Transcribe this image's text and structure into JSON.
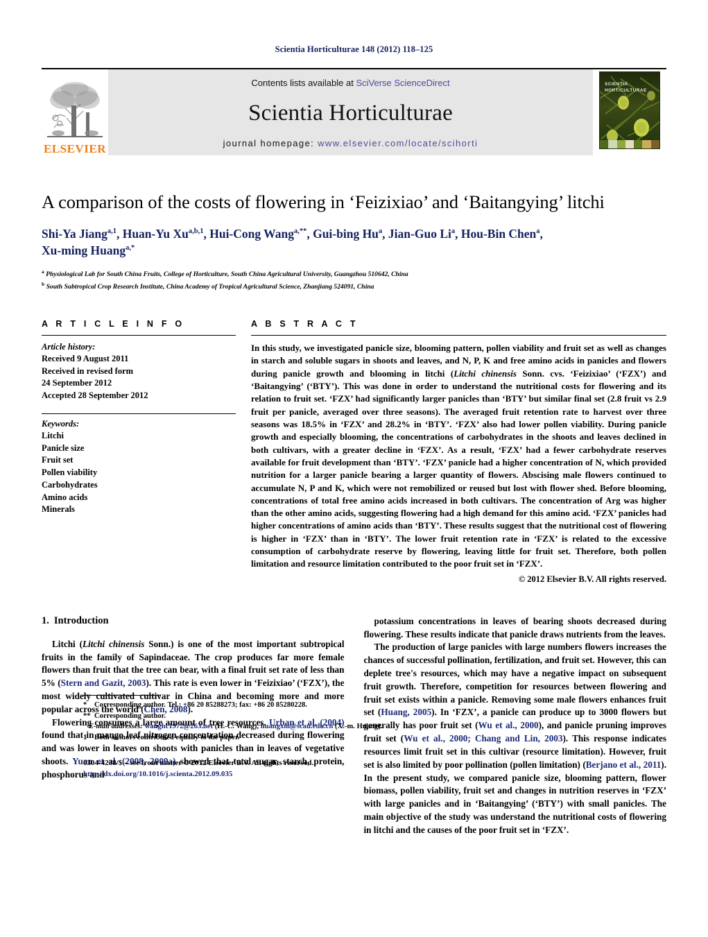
{
  "running_head": "Scientia Horticulturae 148 (2012) 118–125",
  "masthead": {
    "publisher_name": "ELSEVIER",
    "contents_prefix": "Contents lists available at ",
    "contents_link": "SciVerse ScienceDirect",
    "journal_title": "Scientia Horticulturae",
    "homepage_prefix": "journal homepage: ",
    "homepage_url": "www.elsevier.com/locate/scihorti",
    "cover_label_line1": "SCIENTIA",
    "cover_label_line2": "HORTICULTURAE",
    "link_color": "#4a4a9c",
    "logo_color": "#f07e13",
    "panel_bg": "#e6e6e6"
  },
  "article": {
    "title": "A comparison of the costs of flowering in ‘Feizixiao’ and ‘Baitangying’ litchi",
    "authors_line1": "Shi-Ya Jiang<sup>a,1</sup>, Huan-Yu Xu<sup>a,b,1</sup>, Hui-Cong Wang<sup>a,**</sup>, Gui-bing Hu<sup>a</sup>, Jian-Guo Li<sup>a</sup>, Hou-Bin Chen<sup>a</sup>,",
    "authors_line2": "Xu-ming Huang<sup>a,*</sup>",
    "authors_color": "#13205e",
    "affiliation_a": "<sup>a</sup> Physiological Lab for South China Fruits, College of Horticulture, South China Agricultural University, Guangzhou 510642, China",
    "affiliation_b": "<sup>b</sup> South Subtropical Crop Research Institute, China Academy of Tropical Agricultural Science, Zhanjiang 524091, China"
  },
  "article_info": {
    "label": "A R T I C L E   I N F O",
    "history_label": "Article history:",
    "history": [
      "Received 9 August 2011",
      "Received in revised form",
      "24 September 2012",
      "Accepted 28 September 2012"
    ],
    "keywords_label": "Keywords:",
    "keywords": [
      "Litchi",
      "Panicle size",
      "Fruit set",
      "Pollen viability",
      "Carbohydrates",
      "Amino acids",
      "Minerals"
    ]
  },
  "abstract": {
    "label": "A B S T R A C T",
    "html": "In this study, we investigated panicle size, blooming pattern, pollen viability and fruit set as well as changes in starch and soluble sugars in shoots and leaves, and N, P, K and free amino acids in panicles and flowers during panicle growth and blooming in litchi (<em>Litchi chinensis</em> Sonn. cvs. ‘Feizixiao’ (‘FZX’) and ‘Baitangying’ (‘BTY’). This was done in order to understand the nutritional costs for flowering and its relation to fruit set. ‘FZX’ had significantly larger panicles than ‘BTY’ but similar final set (2.8 fruit vs 2.9 fruit per panicle, averaged over three seasons). The averaged fruit retention rate to harvest over three seasons was 18.5% in ‘FZX’ and 28.2% in ‘BTY’. ‘FZX’ also had lower pollen viability. During panicle growth and especially blooming, the concentrations of carbohydrates in the shoots and leaves declined in both cultivars, with a greater decline in ‘FZX’. As a result, ‘FZX’ had a fewer carbohydrate reserves available for fruit development than ‘BTY’. ‘FZX’ panicle had a higher concentration of N, which provided nutrition for a larger panicle bearing a larger quantity of flowers. Abscising male flowers continued to accumulate N, P and K, which were not remobilized or reused but lost with flower shed. Before blooming, concentrations of total free amino acids increased in both cultivars. The concentration of Arg was higher than the other amino acids, suggesting flowering had a high demand for this amino acid. ‘FZX’ panicles had higher concentrations of amino acids than ‘BTY’. These results suggest that the nutritional cost of flowering is higher in ‘FZX’ than in ‘BTY’. The lower fruit retention rate in ‘FZX’ is related to the excessive consumption of carbohydrate reserve by flowering, leaving little for fruit set. Therefore, both pollen limitation and resource limitation contributed to the poor fruit set in ‘FZX’.",
    "copyright": "© 2012 Elsevier B.V. All rights reserved."
  },
  "introduction": {
    "number": "1.",
    "heading": "Introduction",
    "left_paragraphs": [
      "Litchi (<em>Litchi chinensis</em> Sonn.) is one of the most important subtropical fruits in the family of Sapindaceae. The crop produces far more female flowers than fruit that the tree can bear, with a final fruit set rate of less than 5% (<span class=\"cit\">Stern and Gazit, 2003</span>). This rate is even lower in ‘Feizixiao’ (‘FZX’), the most widely cultivated cultivar in China and becoming more and more popular across the world (<span class=\"cit\">Chen, 2008</span>).",
      "Flowering consumes a large amount of tree resources. <span class=\"cit\">Urban et al. (2004)</span> found that in mango leaf nitrogen concentration decreased during flowering and was lower in leaves on shoots with panicles than in leaves of vegetative shoots. <span class=\"cit\">Yuan et al. (2008, 2009a)</span> showed that total sugar, starch, protein, phosphorus and"
    ],
    "right_paragraphs": [
      "potassium concentrations in leaves of bearing shoots decreased during flowering. These results indicate that panicle draws nutrients from the leaves.",
      "The production of large panicles with large numbers flowers increases the chances of successful pollination, fertilization, and fruit set. However, this can deplete tree's resources, which may have a negative impact on subsequent fruit growth. Therefore, competition for resources between flowering and fruit set exists within a panicle. Removing some male flowers enhances fruit set (<span class=\"cit\">Huang, 2005</span>). In ‘FZX’, a panicle can produce up to 3000 flowers but generally has poor fruit set (<span class=\"cit\">Wu et al., 2000</span>), and panicle pruning improves fruit set (<span class=\"cit\">Wu et al., 2000; Chang and Lin, 2003</span>). This response indicates resources limit fruit set in this cultivar (resource limitation). However, fruit set is also limited by poor pollination (pollen limitation) (<span class=\"cit\">Berjano et al., 2011</span>). In the present study, we compared panicle size, blooming pattern, flower biomass, pollen viability, fruit set and changes in nutrition reserves in ‘FZX’ with large panicles and in ‘Baitangying’ (‘BTY’) with small panicles. The main objective of the study was understand the nutritional costs of flowering in litchi and the causes of the poor fruit set in ‘FZX’."
    ]
  },
  "footnotes": {
    "corresponding_1": "Corresponding author. Tel.: +86 20 85288273; fax: +86 20 85280228.",
    "corresponding_1_mark": "*",
    "corresponding_2": "Corresponding author.",
    "corresponding_2_mark": "**",
    "email_label": "E-mail addresses:",
    "email_1": "wanghc1972@263.net",
    "email_1_owner": "(H.-C. Wang),",
    "email_2": "huangxm@scau.edu.cn",
    "email_2_owner": "(X.-m. Huang).",
    "equal_contribution_mark": "1",
    "equal_contribution": "Both authors contributed equally to the paper."
  },
  "imprint": {
    "issn_line": "0304-4238/$ – see front matter © 2012 Elsevier B.V. All rights reserved.",
    "doi": "http://dx.doi.org/10.1016/j.scienta.2012.09.035"
  }
}
